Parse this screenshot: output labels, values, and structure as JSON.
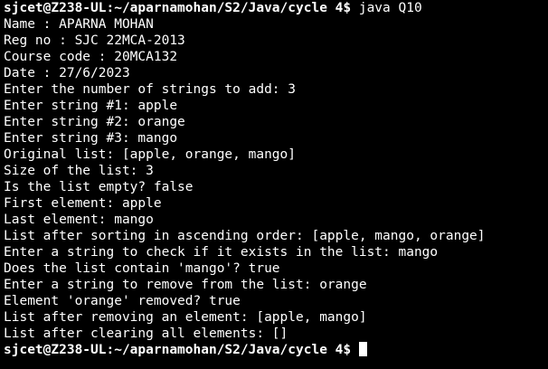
{
  "terminal": {
    "prompt": "sjcet@Z238-UL:~/aparnamohan/S2/Java/cycle 4$",
    "command": " java Q10",
    "output": [
      "Name : APARNA MOHAN",
      "Reg no : SJC 22MCA-2013",
      "Course code : 20MCA132",
      "Date : 27/6/2023",
      "Enter the number of strings to add: 3",
      "Enter string #1: apple",
      "Enter string #2: orange",
      "Enter string #3: mango",
      "Original list: [apple, orange, mango]",
      "Size of the list: 3",
      "Is the list empty? false",
      "First element: apple",
      "Last element: mango",
      "List after sorting in ascending order: [apple, mango, orange]",
      "Enter a string to check if it exists in the list: mango",
      "Does the list contain 'mango'? true",
      "Enter a string to remove from the list: orange",
      "Element 'orange' removed? true",
      "List after removing an element: [apple, mango]",
      "List after clearing all elements: []"
    ],
    "final_prompt": "sjcet@Z238-UL:~/aparnamohan/S2/Java/cycle 4$",
    "colors": {
      "background": "#000000",
      "foreground": "#ffffff"
    }
  }
}
